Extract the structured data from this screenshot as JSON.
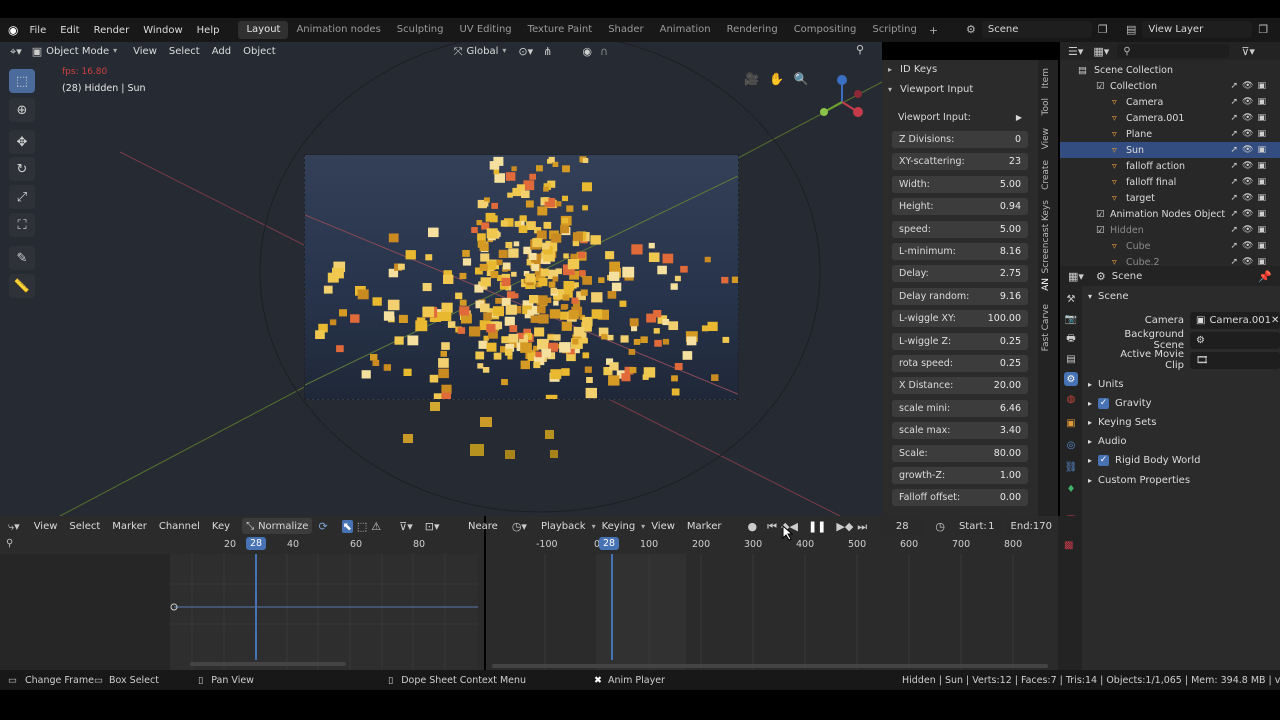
{
  "menu": {
    "file": "File",
    "edit": "Edit",
    "render": "Render",
    "window": "Window",
    "help": "Help"
  },
  "workspaces": [
    "Layout",
    "Animation nodes",
    "Sculpting",
    "UV Editing",
    "Texture Paint",
    "Shader",
    "Animation",
    "Rendering",
    "Compositing",
    "Scripting"
  ],
  "active_workspace": "Layout",
  "scene_name": "Scene",
  "view_layer": "View Layer",
  "viewport_header": {
    "mode": "Object Mode",
    "view": "View",
    "select": "Select",
    "add": "Add",
    "object": "Object",
    "orientation": "Global"
  },
  "viewport": {
    "fps": "fps: 16.80",
    "object_info": "(28) Hidden | Sun"
  },
  "npanel": {
    "id_keys": "ID Keys",
    "viewport_input_header": "Viewport Input",
    "viewport_input_label": "Viewport Input:",
    "fields": [
      {
        "label": "Z Divisions:",
        "value": "0"
      },
      {
        "label": "XY-scattering:",
        "value": "23"
      },
      {
        "label": "Width:",
        "value": "5.00"
      },
      {
        "label": "Height:",
        "value": "0.94"
      },
      {
        "label": "speed:",
        "value": "5.00"
      },
      {
        "label": "L-minimum:",
        "value": "8.16"
      },
      {
        "label": "Delay:",
        "value": "2.75"
      },
      {
        "label": "Delay random:",
        "value": "9.16"
      },
      {
        "label": "L-wiggle XY:",
        "value": "100.00"
      },
      {
        "label": "L-wiggle Z:",
        "value": "0.25"
      },
      {
        "label": "rota speed:",
        "value": "0.25"
      },
      {
        "label": "X Distance:",
        "value": "20.00"
      },
      {
        "label": "scale mini:",
        "value": "6.46"
      },
      {
        "label": "scale max:",
        "value": "3.40"
      },
      {
        "label": "Scale:",
        "value": "80.00"
      },
      {
        "label": "growth-Z:",
        "value": "1.00"
      },
      {
        "label": "Falloff offset:",
        "value": "0.00"
      }
    ],
    "tabs": [
      "Item",
      "Tool",
      "View",
      "Create",
      "Screencast Keys",
      "AN",
      "Fast Carve"
    ]
  },
  "outliner": {
    "root": "Scene Collection",
    "items": [
      {
        "name": "Collection",
        "indent": 1,
        "selected": false
      },
      {
        "name": "Camera",
        "indent": 2,
        "selected": false
      },
      {
        "name": "Camera.001",
        "indent": 2,
        "selected": false
      },
      {
        "name": "Plane",
        "indent": 2,
        "selected": false
      },
      {
        "name": "Sun",
        "indent": 2,
        "selected": true
      },
      {
        "name": "falloff action",
        "indent": 2,
        "selected": false
      },
      {
        "name": "falloff final",
        "indent": 2,
        "selected": false
      },
      {
        "name": "target",
        "indent": 2,
        "selected": false
      },
      {
        "name": "Animation Nodes Object",
        "indent": 1,
        "selected": false
      },
      {
        "name": "Hidden",
        "indent": 1,
        "selected": false
      },
      {
        "name": "Cube",
        "indent": 2,
        "selected": false
      },
      {
        "name": "Cube.2",
        "indent": 2,
        "selected": false
      }
    ]
  },
  "properties": {
    "header": "Scene",
    "panel": "Scene",
    "camera_label": "Camera",
    "camera_value": "Camera.001",
    "background_scene_label": "Background Scene",
    "active_movie_clip_label": "Active Movie Clip",
    "sections": [
      {
        "label": "Units",
        "checkbox": false
      },
      {
        "label": "Gravity",
        "checkbox": true
      },
      {
        "label": "Keying Sets",
        "checkbox": false
      },
      {
        "label": "Audio",
        "checkbox": false
      },
      {
        "label": "Rigid Body World",
        "checkbox": true
      },
      {
        "label": "Custom Properties",
        "checkbox": false
      }
    ]
  },
  "graph_editor": {
    "view": "View",
    "select": "Select",
    "marker": "Marker",
    "channel": "Channel",
    "key": "Key",
    "normalize": "Normalize",
    "ticks": [
      "20",
      "40",
      "60",
      "80"
    ],
    "current_frame": "28"
  },
  "timeline": {
    "nearest": "Neare",
    "playback": "Playback",
    "keying": "Keying",
    "view": "View",
    "marker": "Marker",
    "current_frame": "28",
    "start_label": "Start:",
    "start": "1",
    "end_label": "End:",
    "end": "170",
    "ticks": [
      "-100",
      "0",
      "100",
      "200",
      "300",
      "400",
      "500",
      "600",
      "700",
      "800"
    ]
  },
  "statusbar": {
    "change_frame": "Change Frame",
    "box_select": "Box Select",
    "pan_view": "Pan View",
    "context_menu": "Dope Sheet Context Menu",
    "anim_player": "Anim Player",
    "stats": "Hidden | Sun | Verts:12 | Faces:7 | Tris:14 | Objects:1/1,065 | Mem: 394.8 MB | v2.80.75"
  },
  "colors": {
    "accent": "#4772b3",
    "selected_row": "#334d80",
    "fps": "#d04040"
  }
}
